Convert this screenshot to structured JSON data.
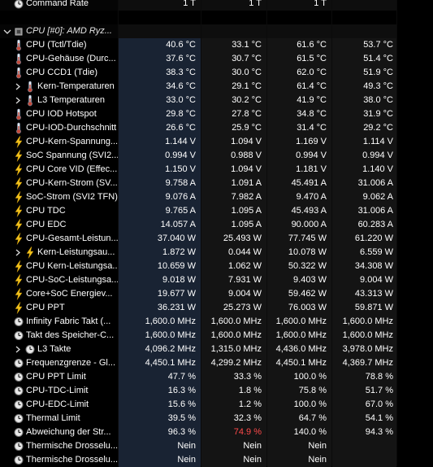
{
  "header_row": {
    "label": "Command Rate",
    "values": [
      "1 T",
      "1 T",
      "1 T",
      ""
    ]
  },
  "group": {
    "label": "CPU [#0]: AMD Ryz..."
  },
  "rows": [
    {
      "label": "CPU (Tctl/Tdie)",
      "icon": "thermometer-icon",
      "indent": 1,
      "expand": false,
      "values": [
        "40.6 °C",
        "33.1 °C",
        "61.6 °C",
        "53.7 °C"
      ],
      "red": [
        false,
        false,
        false,
        false
      ]
    },
    {
      "label": "CPU-Gehäuse (Durc...",
      "icon": "thermometer-icon",
      "indent": 1,
      "expand": false,
      "values": [
        "37.6 °C",
        "30.7 °C",
        "61.5 °C",
        "51.4 °C"
      ],
      "red": [
        false,
        false,
        false,
        false
      ]
    },
    {
      "label": "CPU CCD1 (Tdie)",
      "icon": "thermometer-icon",
      "indent": 1,
      "expand": false,
      "values": [
        "38.3 °C",
        "30.0 °C",
        "62.0 °C",
        "51.9 °C"
      ],
      "red": [
        false,
        false,
        false,
        false
      ]
    },
    {
      "label": "Kern-Temperaturen",
      "icon": "thermometer-icon",
      "indent": 2,
      "expand": true,
      "values": [
        "34.6 °C",
        "29.1 °C",
        "61.4 °C",
        "49.3 °C"
      ],
      "red": [
        false,
        false,
        false,
        false
      ]
    },
    {
      "label": "L3 Temperaturen",
      "icon": "thermometer-icon",
      "indent": 2,
      "expand": true,
      "values": [
        "33.0 °C",
        "30.2 °C",
        "41.9 °C",
        "38.0 °C"
      ],
      "red": [
        false,
        false,
        false,
        false
      ]
    },
    {
      "label": "CPU IOD Hotspot",
      "icon": "thermometer-icon",
      "indent": 1,
      "expand": false,
      "values": [
        "29.8 °C",
        "27.8 °C",
        "34.8 °C",
        "31.9 °C"
      ],
      "red": [
        false,
        false,
        false,
        false
      ]
    },
    {
      "label": "CPU-IOD-Durchschnitt",
      "icon": "thermometer-icon",
      "indent": 1,
      "expand": false,
      "values": [
        "26.6 °C",
        "25.9 °C",
        "31.4 °C",
        "29.2 °C"
      ],
      "red": [
        false,
        false,
        false,
        false
      ]
    },
    {
      "label": "CPU-Kern-Spannung...",
      "icon": "bolt-icon",
      "indent": 1,
      "expand": false,
      "values": [
        "1.144 V",
        "1.094 V",
        "1.169 V",
        "1.114 V"
      ],
      "red": [
        false,
        false,
        false,
        false
      ]
    },
    {
      "label": "SoC Spannung (SVI2...",
      "icon": "bolt-icon",
      "indent": 1,
      "expand": false,
      "values": [
        "0.994 V",
        "0.988 V",
        "0.994 V",
        "0.994 V"
      ],
      "red": [
        false,
        false,
        false,
        false
      ]
    },
    {
      "label": "CPU Core VID (Effec...",
      "icon": "bolt-icon",
      "indent": 1,
      "expand": false,
      "values": [
        "1.150 V",
        "1.094 V",
        "1.181 V",
        "1.140 V"
      ],
      "red": [
        false,
        false,
        false,
        false
      ]
    },
    {
      "label": "CPU-Kern-Strom (SV...",
      "icon": "bolt-icon",
      "indent": 1,
      "expand": false,
      "values": [
        "9.758 A",
        "1.091 A",
        "45.491 A",
        "31.006 A"
      ],
      "red": [
        false,
        false,
        false,
        false
      ]
    },
    {
      "label": "SoC-Strom (SVI2 TFN)",
      "icon": "bolt-icon",
      "indent": 1,
      "expand": false,
      "values": [
        "9.076 A",
        "7.982 A",
        "9.470 A",
        "9.062 A"
      ],
      "red": [
        false,
        false,
        false,
        false
      ]
    },
    {
      "label": "CPU TDC",
      "icon": "bolt-icon",
      "indent": 1,
      "expand": false,
      "values": [
        "9.765 A",
        "1.095 A",
        "45.493 A",
        "31.006 A"
      ],
      "red": [
        false,
        false,
        false,
        false
      ]
    },
    {
      "label": "CPU EDC",
      "icon": "bolt-icon",
      "indent": 1,
      "expand": false,
      "values": [
        "14.057 A",
        "1.095 A",
        "90.000 A",
        "60.283 A"
      ],
      "red": [
        false,
        false,
        false,
        false
      ]
    },
    {
      "label": "CPU-Gesamt-Leistun...",
      "icon": "bolt-icon",
      "indent": 1,
      "expand": false,
      "values": [
        "37.040 W",
        "25.493 W",
        "77.745 W",
        "61.220 W"
      ],
      "red": [
        false,
        false,
        false,
        false
      ]
    },
    {
      "label": "Kern-Leistungsau...",
      "icon": "bolt-icon",
      "indent": 2,
      "expand": true,
      "values": [
        "1.872 W",
        "0.044 W",
        "10.078 W",
        "6.559 W"
      ],
      "red": [
        false,
        false,
        false,
        false
      ]
    },
    {
      "label": "CPU Kern-Leistungsa...",
      "icon": "bolt-icon",
      "indent": 1,
      "expand": false,
      "values": [
        "10.659 W",
        "1.062 W",
        "50.322 W",
        "34.308 W"
      ],
      "red": [
        false,
        false,
        false,
        false
      ]
    },
    {
      "label": "CPU-SoC-Leistungsa...",
      "icon": "bolt-icon",
      "indent": 1,
      "expand": false,
      "values": [
        "9.018 W",
        "7.931 W",
        "9.403 W",
        "9.004 W"
      ],
      "red": [
        false,
        false,
        false,
        false
      ]
    },
    {
      "label": "Core+SoC Energiev...",
      "icon": "bolt-icon",
      "indent": 1,
      "expand": false,
      "values": [
        "19.677 W",
        "9.004 W",
        "59.462 W",
        "43.313 W"
      ],
      "red": [
        false,
        false,
        false,
        false
      ]
    },
    {
      "label": "CPU PPT",
      "icon": "bolt-icon",
      "indent": 1,
      "expand": false,
      "values": [
        "36.231 W",
        "25.273 W",
        "76.003 W",
        "59.871 W"
      ],
      "red": [
        false,
        false,
        false,
        false
      ]
    },
    {
      "label": "Infinity Fabric Takt (...",
      "icon": "clock-icon",
      "indent": 1,
      "expand": false,
      "values": [
        "1,600.0 MHz",
        "1,600.0 MHz",
        "1,600.0 MHz",
        "1,600.0 MHz"
      ],
      "red": [
        false,
        false,
        false,
        false
      ]
    },
    {
      "label": "Takt des Speicher-C...",
      "icon": "clock-icon",
      "indent": 1,
      "expand": false,
      "values": [
        "1,600.0 MHz",
        "1,600.0 MHz",
        "1,600.0 MHz",
        "1,600.0 MHz"
      ],
      "red": [
        false,
        false,
        false,
        false
      ]
    },
    {
      "label": "L3 Takte",
      "icon": "clock-icon",
      "indent": 2,
      "expand": true,
      "values": [
        "4,096.2 MHz",
        "1,315.0 MHz",
        "4,436.0 MHz",
        "3,978.0 MHz"
      ],
      "red": [
        false,
        false,
        false,
        false
      ]
    },
    {
      "label": "Frequenzgrenze - Gl...",
      "icon": "clock-icon",
      "indent": 1,
      "expand": false,
      "values": [
        "4,450.1 MHz",
        "4,299.2 MHz",
        "4,450.1 MHz",
        "4,369.7 MHz"
      ],
      "red": [
        false,
        false,
        false,
        false
      ]
    },
    {
      "label": "CPU PPT Limit",
      "icon": "clock-icon",
      "indent": 1,
      "expand": false,
      "values": [
        "47.7 %",
        "33.3 %",
        "100.0 %",
        "78.8 %"
      ],
      "red": [
        false,
        false,
        false,
        false
      ]
    },
    {
      "label": "CPU-TDC-Limit",
      "icon": "clock-icon",
      "indent": 1,
      "expand": false,
      "values": [
        "16.3 %",
        "1.8 %",
        "75.8 %",
        "51.7 %"
      ],
      "red": [
        false,
        false,
        false,
        false
      ]
    },
    {
      "label": "CPU-EDC-Limit",
      "icon": "clock-icon",
      "indent": 1,
      "expand": false,
      "values": [
        "15.6 %",
        "1.2 %",
        "100.0 %",
        "67.0 %"
      ],
      "red": [
        false,
        false,
        false,
        false
      ]
    },
    {
      "label": "Thermal Limit",
      "icon": "clock-icon",
      "indent": 1,
      "expand": false,
      "values": [
        "39.5 %",
        "32.3 %",
        "64.7 %",
        "54.1 %"
      ],
      "red": [
        false,
        false,
        false,
        false
      ]
    },
    {
      "label": "Abweichung der Str...",
      "icon": "clock-icon",
      "indent": 1,
      "expand": false,
      "values": [
        "96.3 %",
        "74.9 %",
        "140.0 %",
        "94.3 %"
      ],
      "red": [
        false,
        true,
        false,
        false
      ]
    },
    {
      "label": "Thermische Drosselu...",
      "icon": "clock-icon",
      "indent": 1,
      "expand": false,
      "values": [
        "Nein",
        "Nein",
        "Nein",
        ""
      ],
      "red": [
        false,
        false,
        false,
        false
      ]
    },
    {
      "label": "Thermische Drosselu...",
      "icon": "clock-icon",
      "indent": 1,
      "expand": false,
      "values": [
        "Nein",
        "Nein",
        "Nein",
        ""
      ],
      "red": [
        false,
        false,
        false,
        false
      ]
    }
  ]
}
